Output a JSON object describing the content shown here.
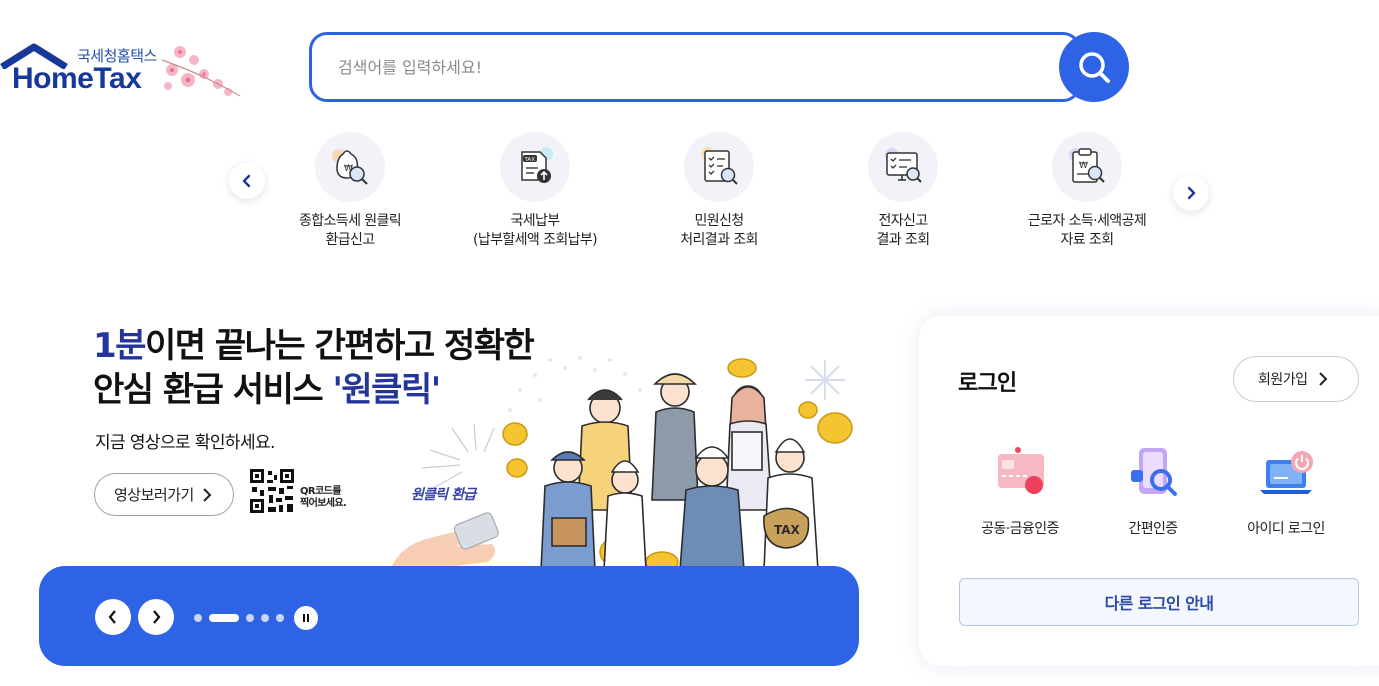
{
  "header": {
    "logo_sub": "국세청홈택스",
    "logo_main": "HomeTax",
    "search_placeholder": "검색어를 입력하세요!"
  },
  "quick_menu": {
    "items": [
      {
        "line1": "종합소득세 원클릭",
        "line2": "환급신고",
        "icon": "money-bag-magnifier-icon"
      },
      {
        "line1": "국세납부",
        "line2": "(납부할세액 조회납부)",
        "icon": "tax-document-upload-icon"
      },
      {
        "line1": "민원신청",
        "line2": "처리결과 조회",
        "icon": "checklist-magnifier-icon"
      },
      {
        "line1": "전자신고",
        "line2": "결과 조회",
        "icon": "monitor-checklist-icon"
      },
      {
        "line1": "근로자 소득·세액공제",
        "line2": "자료 조회",
        "icon": "clipboard-won-magnifier-icon"
      }
    ]
  },
  "banner": {
    "title_highlight": "1분",
    "title_line1_rest": "이면 끝나는 간편하고 정확한",
    "title_line2_start": "안심 환급 서비스 ",
    "title_line2_highlight": "'원클릭'",
    "subtitle": "지금 영상으로 확인하세요.",
    "video_button": "영상보러가기",
    "qr_line1": "QR코드를",
    "qr_line2": "찍어보세요.",
    "art_tag": "원클릭 환급",
    "slide_count": 5,
    "active_slide": 2
  },
  "login": {
    "title": "로그인",
    "signup": "회원가입",
    "options": [
      {
        "label": "공동·금융인증",
        "icon": "certificate-card-icon"
      },
      {
        "label": "간편인증",
        "icon": "phone-magnifier-icon"
      },
      {
        "label": "아이디 로그인",
        "icon": "laptop-power-icon"
      }
    ],
    "other_login": "다른 로그인 안내"
  },
  "colors": {
    "primary": "#2e63e6",
    "logo_blue": "#16389a",
    "title_navy": "#23349a"
  }
}
